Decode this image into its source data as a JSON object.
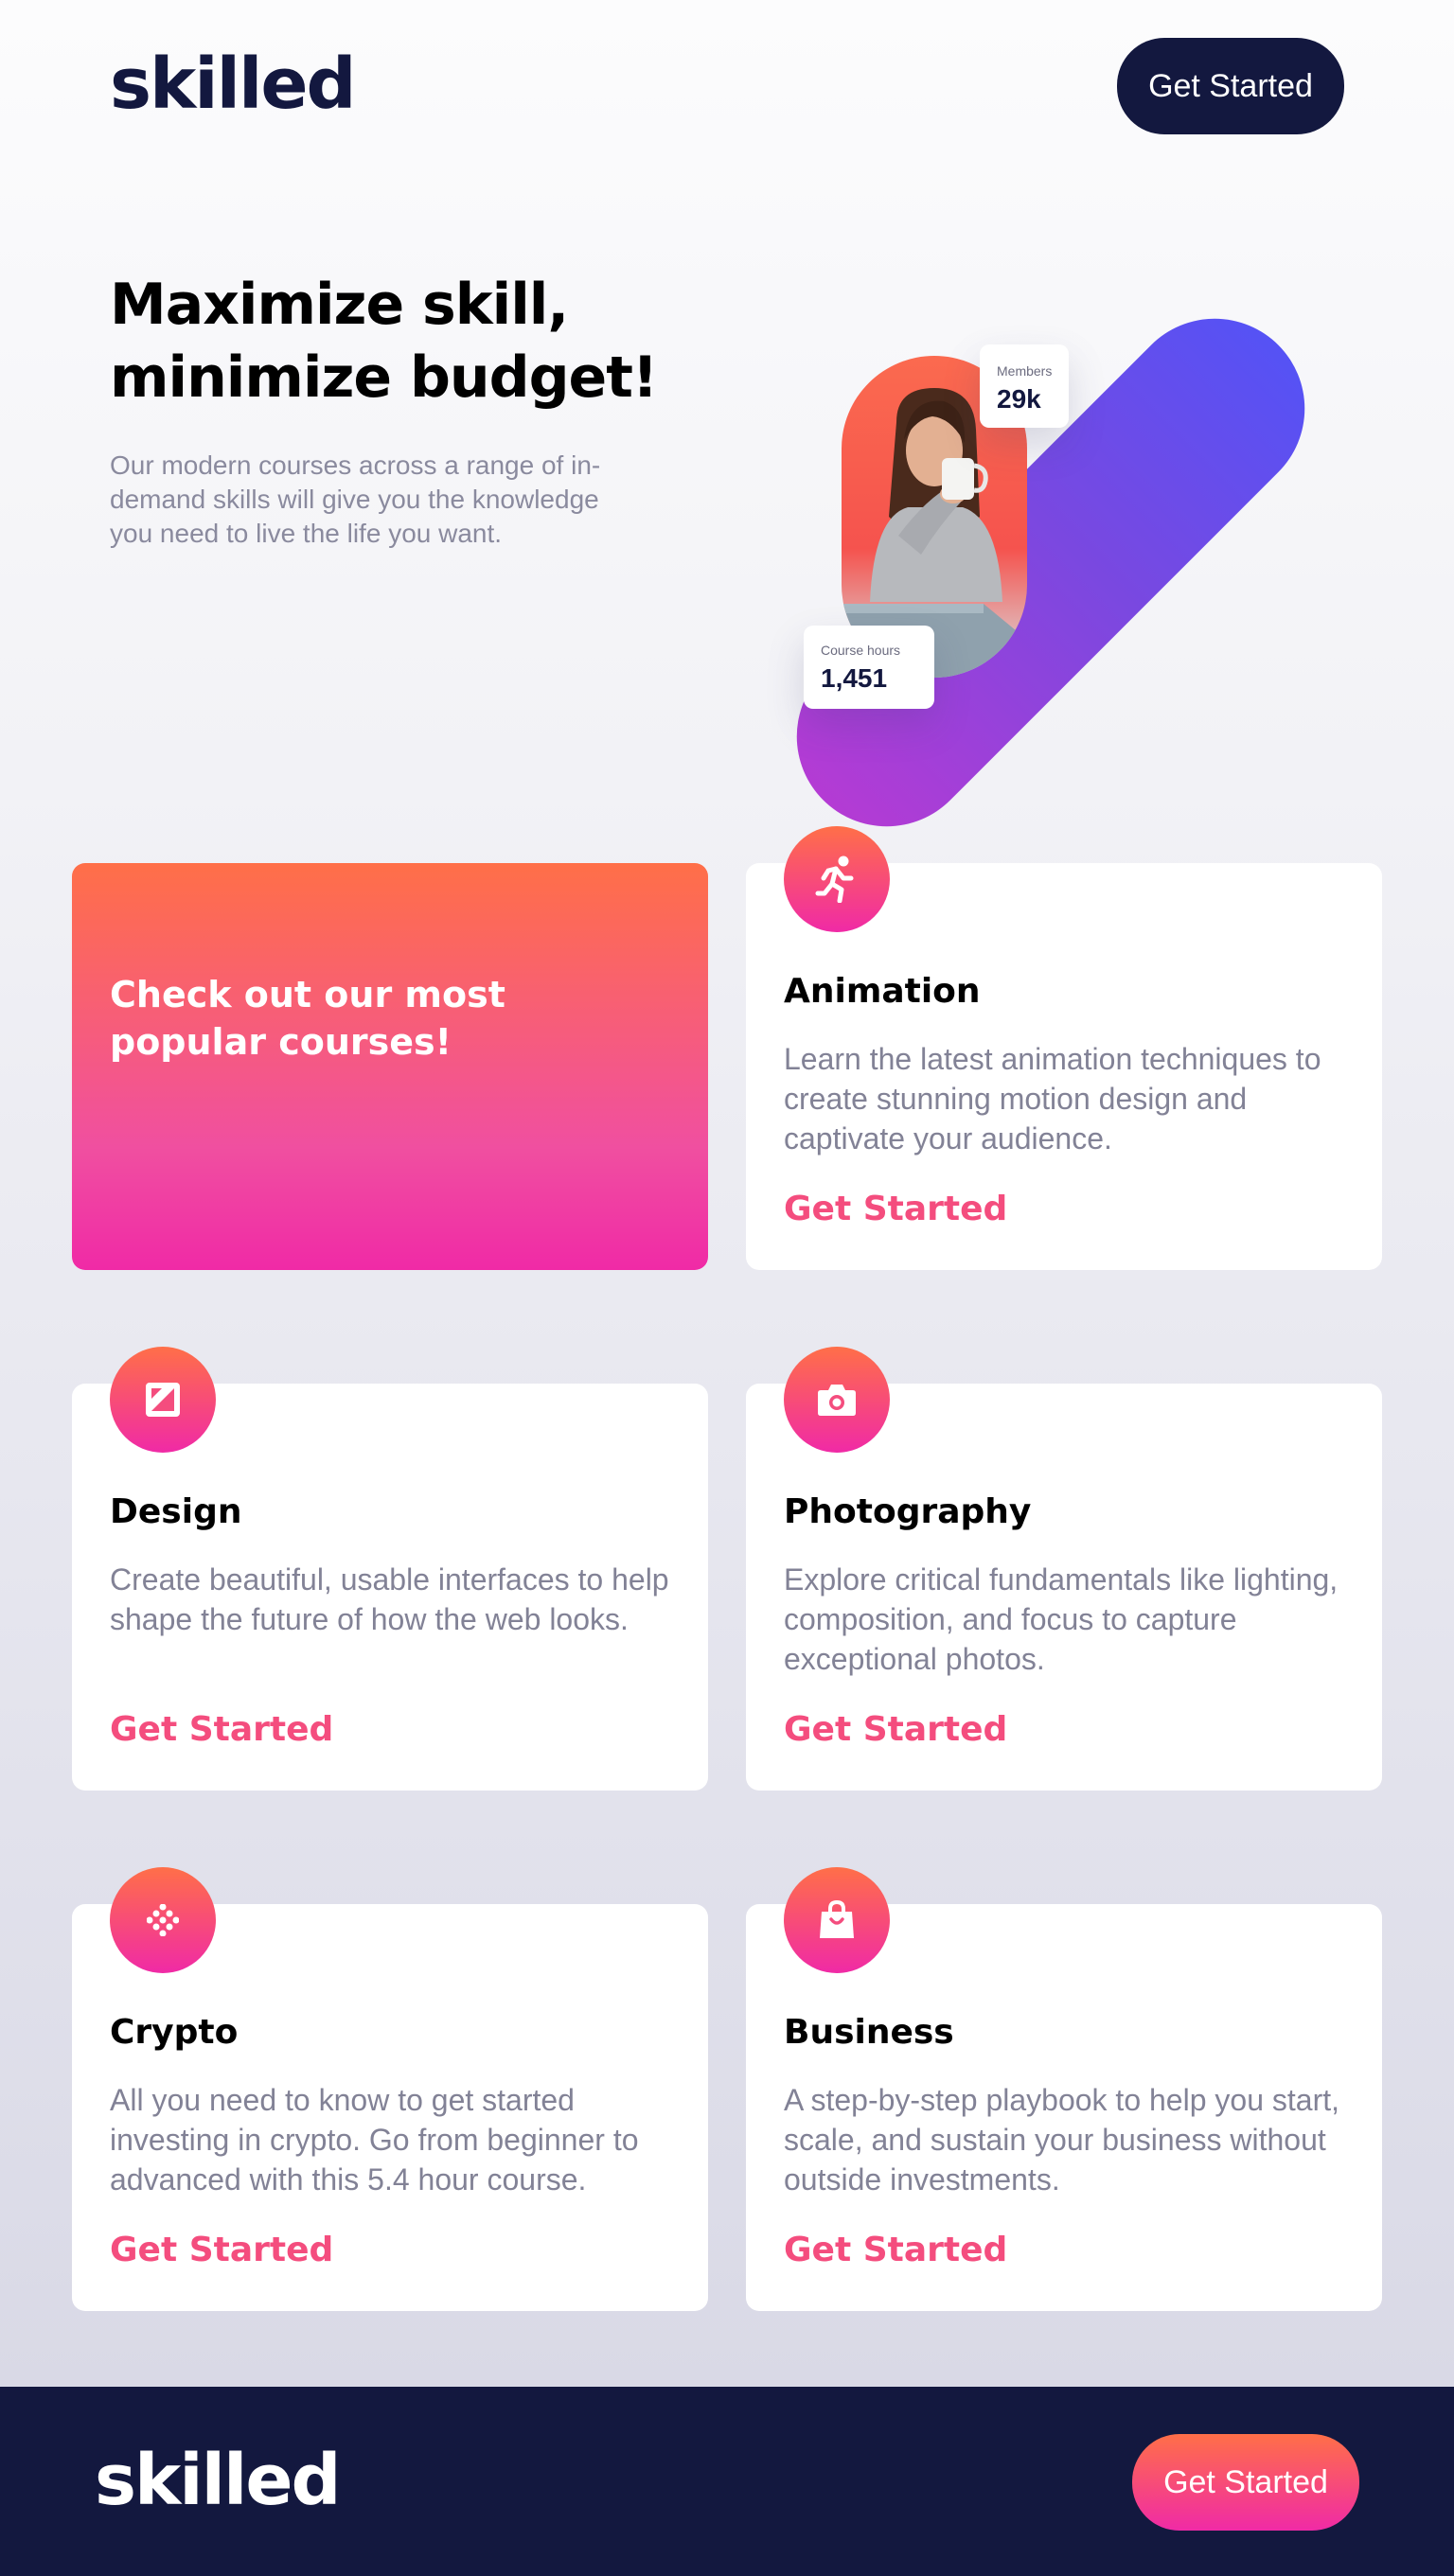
{
  "brand": {
    "logo": "skilled",
    "primary_color": "#13183f",
    "accent_color": "#f44d7e",
    "gradient": [
      "#ff6f48",
      "#f02aa6"
    ]
  },
  "header": {
    "cta_label": "Get Started"
  },
  "hero": {
    "title": "Maximize skill, minimize budget!",
    "subtitle": "Our modern courses across a range of in-demand skills will give you the knowledge you need to live the life you want.",
    "stats": {
      "members": {
        "label": "Members",
        "value": "29k"
      },
      "hours": {
        "label": "Course hours",
        "value": "1,451"
      }
    },
    "photo": "woman-with-mug-and-laptop"
  },
  "promo": {
    "text": "Check out our most popular courses!"
  },
  "courses": [
    {
      "icon": "running-person-icon",
      "title": "Animation",
      "description": "Learn the latest animation techniques to create stunning motion design and captivate your audience.",
      "cta": "Get Started"
    },
    {
      "icon": "design-icon",
      "title": "Design",
      "description": "Create beautiful, usable interfaces to help shape the future of how the web looks.",
      "cta": "Get Started"
    },
    {
      "icon": "camera-icon",
      "title": "Photography",
      "description": "Explore critical fundamentals like lighting, composition, and focus to capture exceptional photos.",
      "cta": "Get Started"
    },
    {
      "icon": "crypto-icon",
      "title": "Crypto",
      "description": "All you need to know to get started investing in crypto. Go from beginner to advanced with this 5.4 hour course.",
      "cta": "Get Started"
    },
    {
      "icon": "shopping-bag-icon",
      "title": "Business",
      "description": "A step-by-step playbook to help you start, scale, and sustain your business without outside investments.",
      "cta": "Get Started"
    }
  ],
  "footer": {
    "logo": "skilled",
    "cta_label": "Get Started"
  }
}
